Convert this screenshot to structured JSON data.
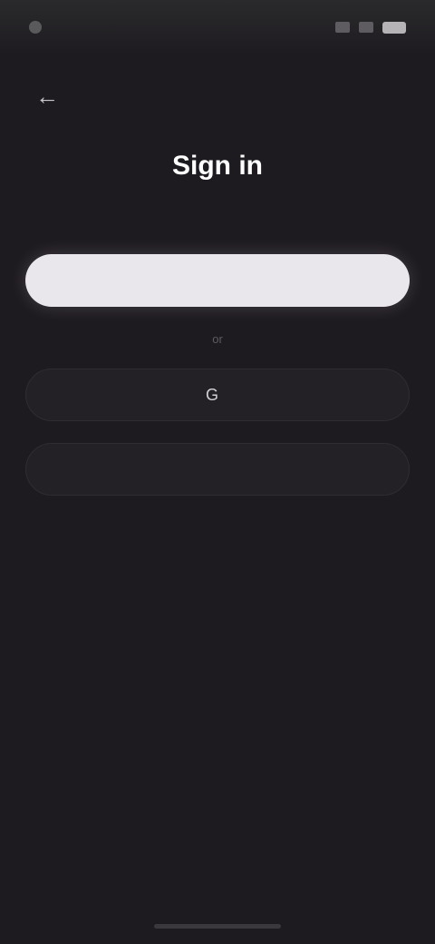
{
  "status_bar": {
    "time": "",
    "icons": [
      "signal-icon",
      "wifi-icon",
      "battery-icon"
    ]
  },
  "header": {
    "back_icon": "back-arrow-icon",
    "back_glyph": "←"
  },
  "auth": {
    "title": "Sign in",
    "subtitle": "",
    "primary_button": {
      "label": "",
      "color": "#e9e6ec"
    },
    "or_label": "or",
    "google_button": {
      "label": "",
      "icon": "google-icon",
      "glyph": "G"
    },
    "apple_button": {
      "label": "",
      "icon": "apple-icon",
      "glyph": ""
    },
    "alt_link": "",
    "legal_text": "",
    "learn_more": ""
  },
  "colors": {
    "background": "#1e1b20",
    "primary_button_bg": "#e9e6ec",
    "outline_button_bg": "#242126"
  }
}
